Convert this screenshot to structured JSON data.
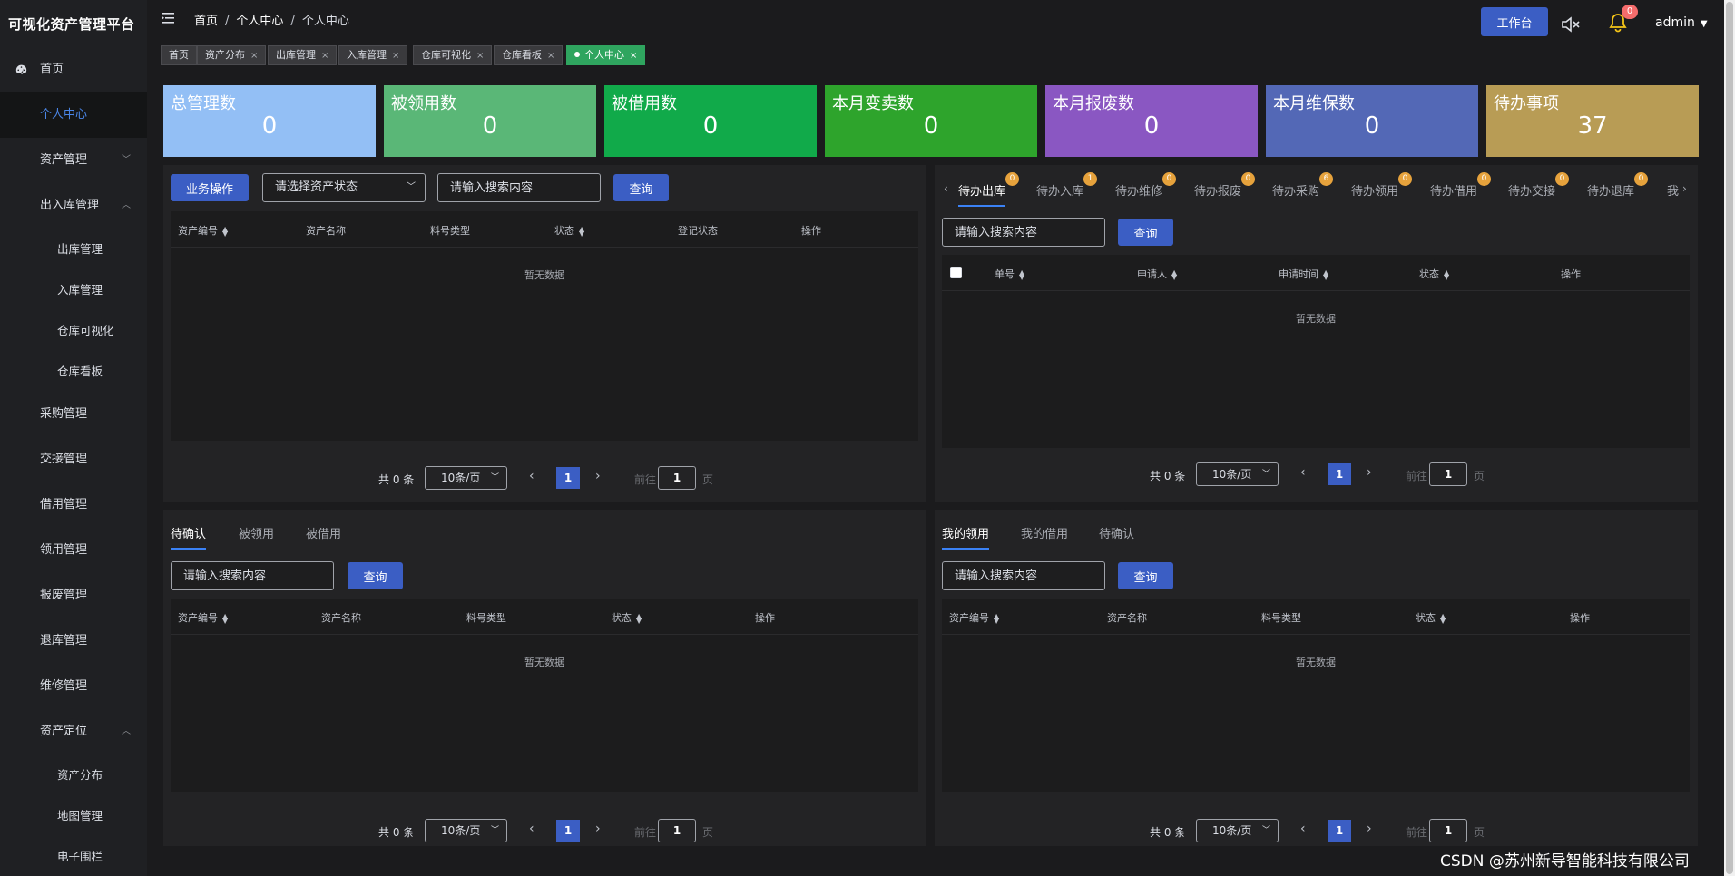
{
  "brand": "可视化资产管理平台",
  "sidebar": {
    "items": [
      {
        "label": "首页",
        "type": "home"
      },
      {
        "label": "个人中心",
        "type": "active"
      },
      {
        "label": "资产管理",
        "chevron": "down"
      },
      {
        "label": "出入库管理",
        "chevron": "up"
      },
      {
        "label": "出库管理",
        "type": "sub"
      },
      {
        "label": "入库管理",
        "type": "sub"
      },
      {
        "label": "仓库可视化",
        "type": "sub"
      },
      {
        "label": "仓库看板",
        "type": "sub"
      },
      {
        "label": "采购管理"
      },
      {
        "label": "交接管理"
      },
      {
        "label": "借用管理"
      },
      {
        "label": "领用管理"
      },
      {
        "label": "报废管理"
      },
      {
        "label": "退库管理"
      },
      {
        "label": "维修管理"
      },
      {
        "label": "资产定位",
        "chevron": "up"
      },
      {
        "label": "资产分布",
        "type": "sub"
      },
      {
        "label": "地图管理",
        "type": "sub"
      },
      {
        "label": "电子围栏",
        "type": "sub"
      }
    ]
  },
  "header": {
    "breadcrumb": [
      "首页",
      "个人中心",
      "个人中心"
    ],
    "workbench_label": "工作台",
    "notification_count": "0",
    "user": "admin"
  },
  "tags": [
    {
      "label": "首页",
      "closable": false
    },
    {
      "label": "资产分布",
      "closable": true
    },
    {
      "label": "出库管理",
      "closable": true
    },
    {
      "label": "入库管理",
      "closable": true
    },
    {
      "label": "仓库可视化",
      "closable": true
    },
    {
      "label": "仓库看板",
      "closable": true
    },
    {
      "label": "个人中心",
      "closable": true,
      "active": true
    }
  ],
  "stats": [
    {
      "label": "总管理数",
      "value": "0",
      "color": "#93bff5"
    },
    {
      "label": "被领用数",
      "value": "0",
      "color": "#5ab777"
    },
    {
      "label": "被借用数",
      "value": "0",
      "color": "#11aa4a"
    },
    {
      "label": "本月变卖数",
      "value": "0",
      "color": "#2ea42c"
    },
    {
      "label": "本月报废数",
      "value": "0",
      "color": "#8a57c2"
    },
    {
      "label": "本月维保数",
      "value": "0",
      "color": "#5368b6"
    },
    {
      "label": "待办事项",
      "value": "37",
      "color": "#b89c55"
    }
  ],
  "panel_assets": {
    "action_button": "业务操作",
    "status_select_placeholder": "请选择资产状态",
    "search_placeholder": "请输入搜索内容",
    "query_button": "查询",
    "columns": [
      "资产编号",
      "资产名称",
      "料号类型",
      "状态",
      "登记状态",
      "操作"
    ],
    "empty_text": "暂无数据"
  },
  "panel_todo": {
    "tabs": [
      {
        "label": "待办出库",
        "count": "0"
      },
      {
        "label": "待办入库",
        "count": "1"
      },
      {
        "label": "待办维修",
        "count": "0"
      },
      {
        "label": "待办报废",
        "count": "0"
      },
      {
        "label": "待办采购",
        "count": "6"
      },
      {
        "label": "待办领用",
        "count": "0"
      },
      {
        "label": "待办借用",
        "count": "0"
      },
      {
        "label": "待办交接",
        "count": "0"
      },
      {
        "label": "待办退库",
        "count": "0"
      },
      {
        "label": "我",
        "count": ""
      }
    ],
    "search_placeholder": "请输入搜索内容",
    "query_button": "查询",
    "columns": [
      "单号",
      "申请人",
      "申请时间",
      "状态",
      "操作"
    ],
    "empty_text": "暂无数据"
  },
  "panel_confirm": {
    "tabs": [
      "待确认",
      "被领用",
      "被借用"
    ],
    "search_placeholder": "请输入搜索内容",
    "query_button": "查询",
    "columns": [
      "资产编号",
      "资产名称",
      "料号类型",
      "状态",
      "操作"
    ],
    "empty_text": "暂无数据"
  },
  "panel_mine": {
    "tabs": [
      "我的领用",
      "我的借用",
      "待确认"
    ],
    "search_placeholder": "请输入搜索内容",
    "query_button": "查询",
    "columns": [
      "资产编号",
      "资产名称",
      "料号类型",
      "状态",
      "操作"
    ],
    "empty_text": "暂无数据"
  },
  "pagination": {
    "total": "共 0 条",
    "page_size": "10条/页",
    "current_page": "1",
    "goto_label": "前往",
    "goto_value": "1",
    "page_unit": "页"
  },
  "watermark": "CSDN @苏州新导智能科技有限公司"
}
